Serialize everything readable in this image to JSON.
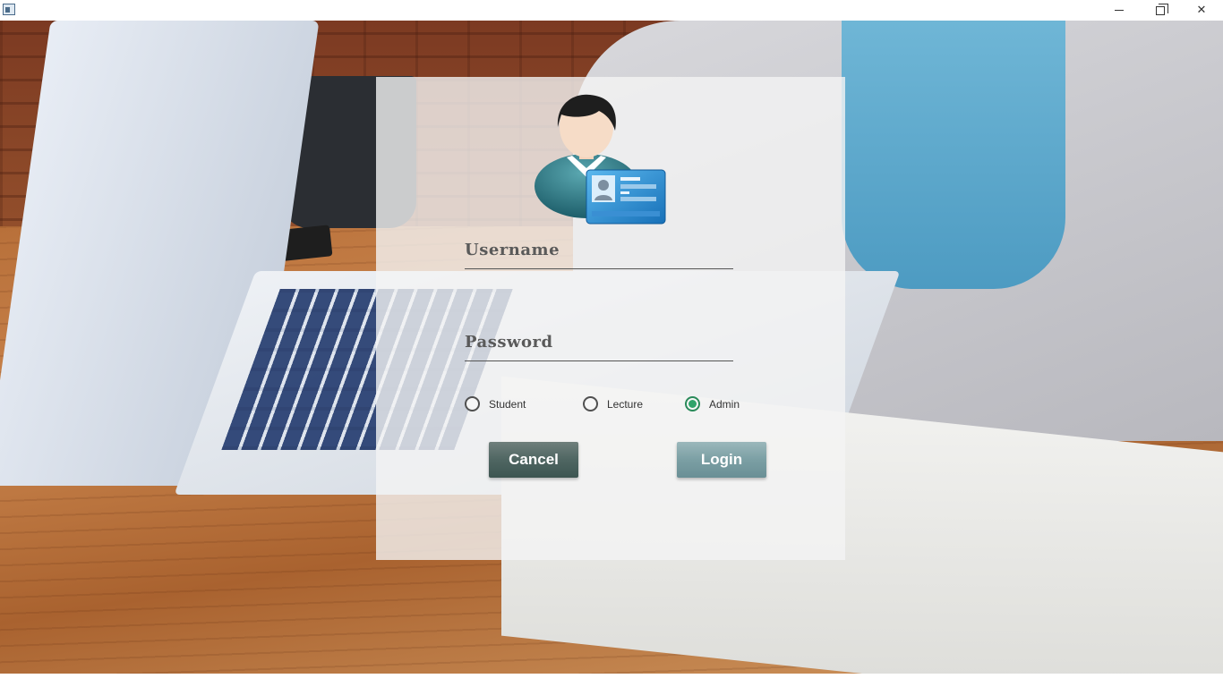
{
  "window": {
    "minimize_icon": "minimize-icon",
    "maximize_icon": "restore-icon",
    "close_icon": "close-icon",
    "close_glyph": "✕"
  },
  "login": {
    "avatar_icon": "user-id-card-icon",
    "username_label": "Username",
    "password_label": "Password",
    "username_value": "",
    "password_value": "",
    "roles": [
      {
        "label": "Student",
        "checked": false
      },
      {
        "label": "Lecture",
        "checked": false
      },
      {
        "label": "Admin",
        "checked": true
      }
    ],
    "cancel_label": "Cancel",
    "login_label": "Login"
  },
  "colors": {
    "panel_bg": "#f4f4f4",
    "radio_selected": "#2fa36a",
    "cancel_button": "#4f6662",
    "login_button": "#7b9fa4"
  }
}
